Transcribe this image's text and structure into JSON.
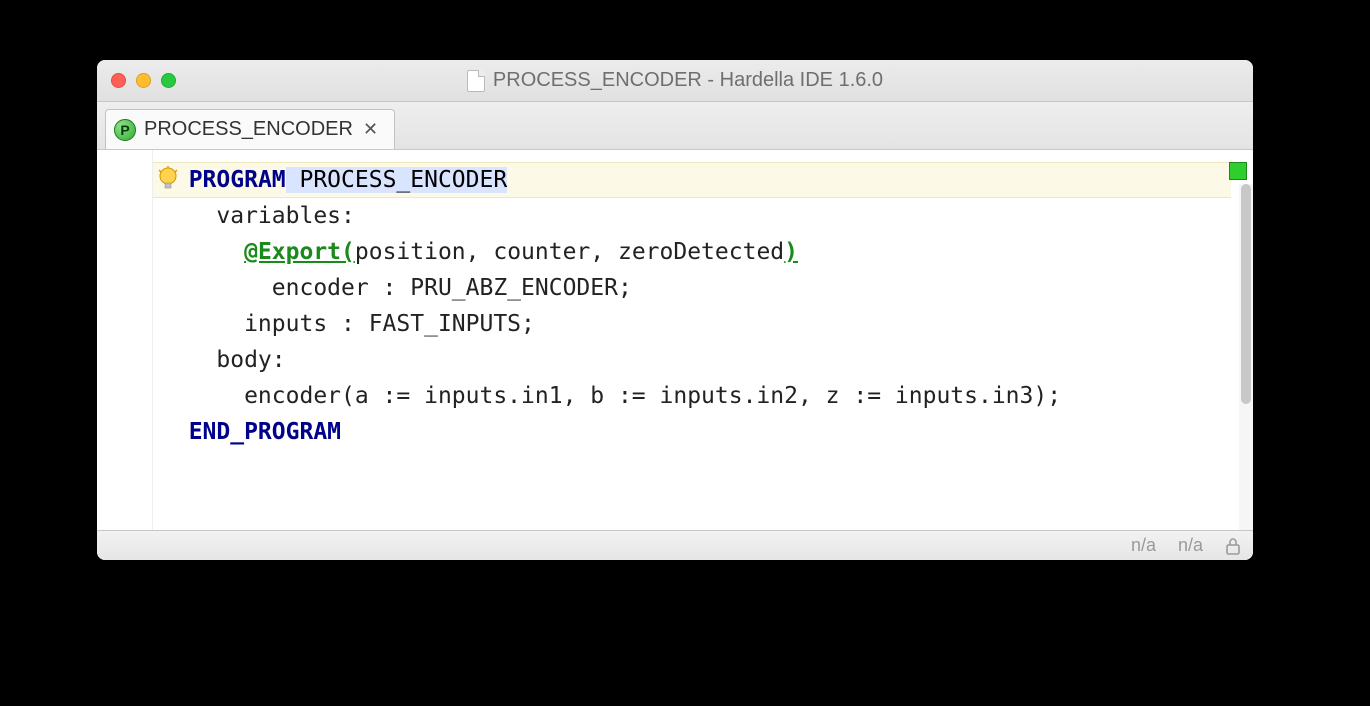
{
  "window": {
    "title": "PROCESS_ENCODER - Hardella IDE 1.6.0"
  },
  "tab": {
    "label": "PROCESS_ENCODER",
    "icon_letter": "P"
  },
  "code": {
    "kw_program": "PROGRAM",
    "prog_name": " PROCESS_ENCODER",
    "variables_label": "    variables:",
    "export_open": "@Export(",
    "export_args": "position, counter, zeroDetected",
    "export_close": ")",
    "encoder_decl": "        encoder : PRU_ABZ_ENCODER;",
    "inputs_decl": "      inputs : FAST_INPUTS;",
    "blank": "",
    "body_label": "    body:",
    "body_line": "      encoder(a := inputs.in1, b := inputs.in2, z := inputs.in3);",
    "kw_end": "  END_PROGRAM"
  },
  "status": {
    "left": "n/a",
    "right": "n/a"
  }
}
